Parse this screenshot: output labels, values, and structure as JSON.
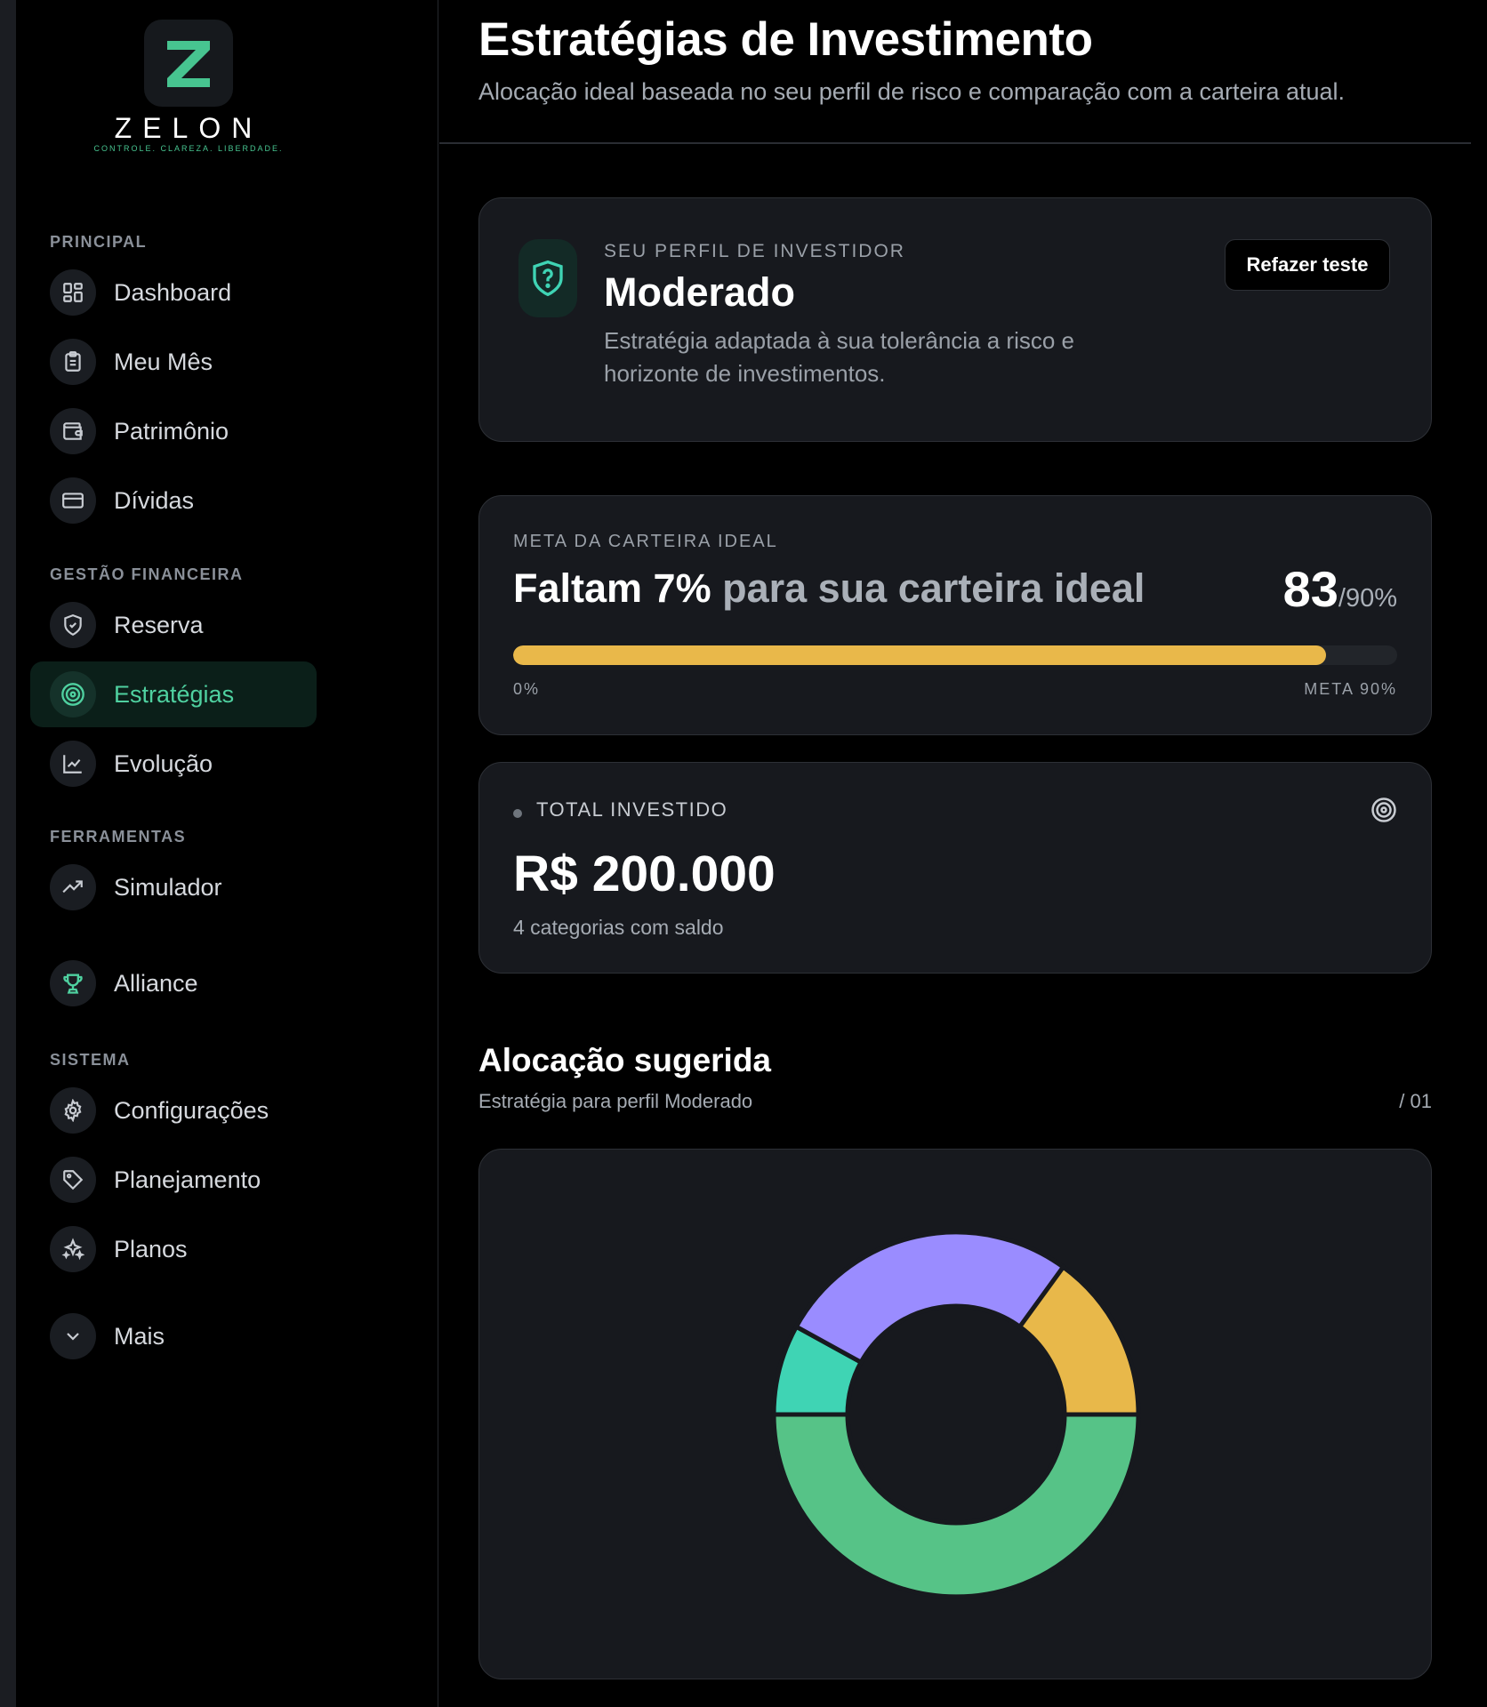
{
  "brand": {
    "name": "ZELON",
    "tagline": "CONTROLE. CLAREZA. LIBERDADE.",
    "accent": "#47c490"
  },
  "sidebar": {
    "sections": [
      {
        "title": "PRINCIPAL"
      },
      {
        "title": "GESTÃO FINANCEIRA"
      },
      {
        "title": "FERRAMENTAS"
      },
      {
        "title": "SISTEMA"
      }
    ],
    "items": [
      {
        "label": "Dashboard",
        "icon": "dashboard-icon"
      },
      {
        "label": "Meu Mês",
        "icon": "clipboard-icon"
      },
      {
        "label": "Patrimônio",
        "icon": "wallet-icon"
      },
      {
        "label": "Dívidas",
        "icon": "credit-card-icon"
      },
      {
        "label": "Reserva",
        "icon": "shield-icon"
      },
      {
        "label": "Estratégias",
        "icon": "target-icon",
        "active": true
      },
      {
        "label": "Evolução",
        "icon": "line-chart-icon"
      },
      {
        "label": "Simulador",
        "icon": "trending-up-icon"
      },
      {
        "label": "Alliance",
        "icon": "trophy-icon"
      },
      {
        "label": "Configurações",
        "icon": "gear-icon"
      },
      {
        "label": "Planejamento",
        "icon": "tag-icon"
      },
      {
        "label": "Planos",
        "icon": "sparkles-icon"
      },
      {
        "label": "Mais",
        "icon": "chevron-down-icon"
      }
    ]
  },
  "header": {
    "title": "Estratégias de Investimento",
    "subtitle": "Alocação ideal baseada no seu perfil de risco e comparação com a carteira atual."
  },
  "profile": {
    "kicker": "SEU PERFIL DE INVESTIDOR",
    "name": "Moderado",
    "description": "Estratégia adaptada à sua tolerância a risco e horizonte de investimentos.",
    "button_label": "Refazer teste"
  },
  "goal": {
    "kicker": "META DA CARTEIRA IDEAL",
    "headline_strong": "Faltam 7%",
    "headline_rest": " para sua carteira ideal",
    "current": "83",
    "target_suffix": "/90%",
    "progress_fraction": 0.92,
    "min_label": "0%",
    "max_label": "META 90%",
    "bar_color": "#e9b84a"
  },
  "total": {
    "kicker": "TOTAL INVESTIDO",
    "value": "R$ 200.000",
    "sub": "4 categorias com saldo"
  },
  "allocation": {
    "title": "Alocação sugerida",
    "subtitle": "Estratégia para perfil Moderado",
    "index": "/ 01"
  },
  "chart_data": {
    "type": "pie",
    "variant": "donut",
    "values": [
      50,
      8,
      27,
      15
    ],
    "colors": [
      "#56c387",
      "#3fd4b4",
      "#9a8cff",
      "#e8b84a"
    ],
    "start_angle_deg": 90,
    "direction": "clockwise",
    "legend": "none"
  }
}
